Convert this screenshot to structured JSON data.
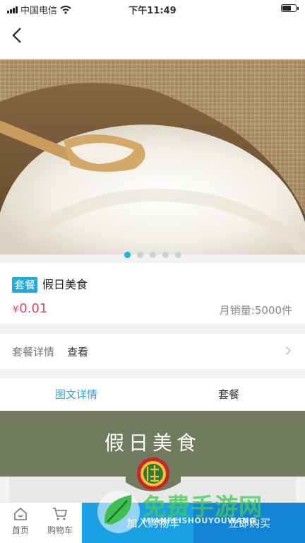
{
  "status_bar": {
    "carrier": "中国电信",
    "time": "下午11:49"
  },
  "product": {
    "tag": "套餐",
    "name": "假日美食",
    "currency": "¥",
    "price": "0.01",
    "monthly_sales": "月销量:5000件"
  },
  "carousel": {
    "slide_count": 5,
    "active_index": 0
  },
  "detail_row": {
    "label": "套餐详情",
    "link": "查看"
  },
  "tabs": [
    {
      "label": "图文详情",
      "active": true
    },
    {
      "label": "套餐",
      "active": false
    }
  ],
  "banner": {
    "title": "假日美食"
  },
  "bottom_bar": {
    "home_label": "首页",
    "cart_nav_label": "购物车",
    "add_cart_label": "加入购物车",
    "buy_now_label": "立即购买"
  },
  "watermark": {
    "cn": "免费手游网",
    "en": "MIANFEISHOUYOUWANG"
  },
  "colors": {
    "accent": "#21a7e2",
    "price": "#e0495c",
    "banner": "#717a5d",
    "cart_button": "#1aa1e4",
    "buy_button": "#1485d6"
  },
  "icons": [
    "back-arrow-icon",
    "chevron-right-icon",
    "home-icon",
    "cart-icon",
    "seal-logo-icon",
    "wifi-icon",
    "battery-icon"
  ]
}
